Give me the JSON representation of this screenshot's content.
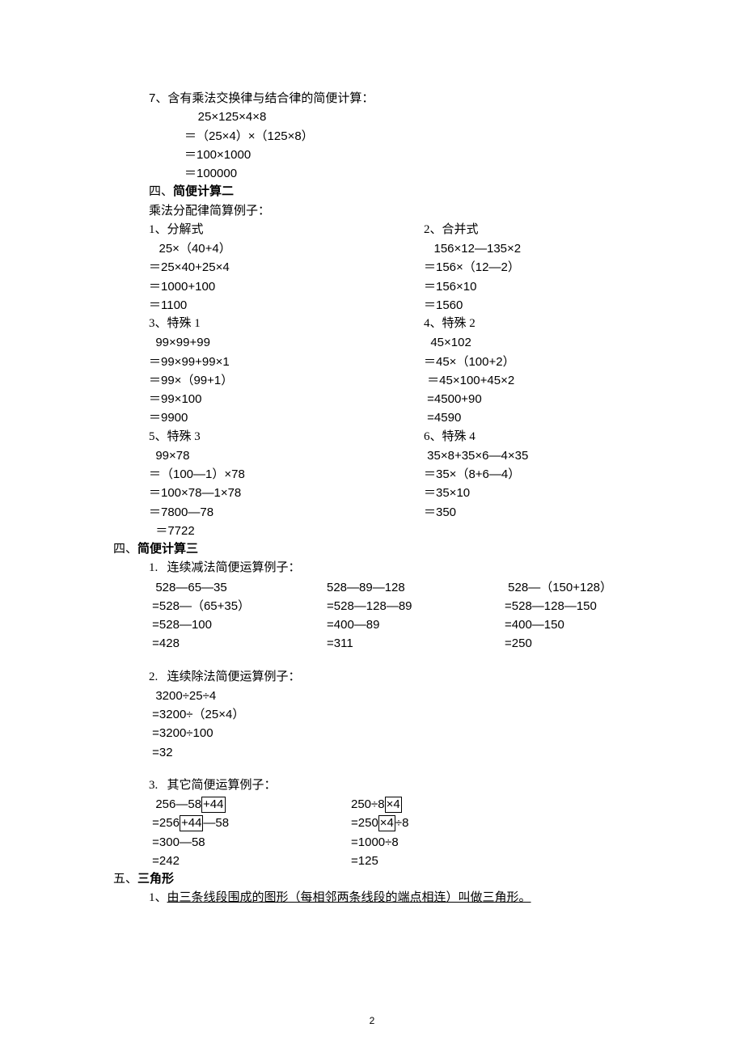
{
  "item7": {
    "heading": "7、含有乘法交换律与结合律的简便计算：",
    "l1": "    25×125×4×8",
    "l2": "＝（25×4）×（125×8）",
    "l3": "＝100×1000",
    "l4": "＝100000"
  },
  "sec4a": {
    "heading_pre": " 四、",
    "heading_bold": "简便计算二",
    "sub": "乘法分配律简算例子："
  },
  "b1": {
    "left_h": "1、分解式",
    "right_h": "2、合并式",
    "l1l": "   25×（40+4）",
    "l1r": "   156×12―135×2",
    "l2l": "＝25×40+25×4",
    "l2r": "＝156×（12―2）",
    "l3l": "＝1000+100",
    "l3r": "＝156×10",
    "l4l": "＝1100",
    "l4r": "＝1560"
  },
  "b2": {
    "left_h": "3、特殊 1",
    "right_h": "4、特殊 2",
    "l1l": "  99×99+99",
    "l1r": "  45×102",
    "l2l": "＝99×99+99×1",
    "l2r": "＝45×（100+2）",
    "l3l": "＝99×（99+1）",
    "l3r": " ＝45×100+45×2",
    "l4l": "＝99×100",
    "l4r": " =4500+90",
    "l5l": "＝9900",
    "l5r": " =4590"
  },
  "b3": {
    "left_h": "5、特殊 3",
    "right_h": "6、特殊 4",
    "l1l": "  99×78",
    "l1r": " 35×8+35×6―4×35",
    "l2l": "＝（100―1）×78",
    "l2r": "＝35×（8+6―4）",
    "l3l": "＝100×78―1×78",
    "l3r": "＝35×10",
    "l4l": "＝7800―78",
    "l4r": "＝350",
    "l5l": "  ＝7722"
  },
  "sec4b": {
    "heading_pre": "四、",
    "heading_bold": "简便计算三"
  },
  "sub1": {
    "heading": "1.   连续减法简便运算例子：",
    "r1c1": "  528―65―35",
    "r1c2": "528―89―128",
    "r1c3": " 528―（150+128）",
    "r2c1": " =528―（65+35）",
    "r2c2": "=528―128―89",
    "r2c3": "=528―128―150",
    "r3c1": " =528―100",
    "r3c2": "=400―89",
    "r3c3": "=400―150",
    "r4c1": " =428",
    "r4c2": "=311",
    "r4c3": "=250"
  },
  "sub2": {
    "heading": "2.   连续除法简便运算例子：",
    "l1": "  3200÷25÷4",
    "l2": " =3200÷（25×4）",
    "l3": " =3200÷100",
    "l4": " =32"
  },
  "sub3": {
    "heading": "3.   其它简便运算例子：",
    "a1pre": "  256―58",
    "a1box": "+44",
    "b1pre": "250÷8",
    "b1box": "×4",
    "a2pre": " =256",
    "a2box": "+44",
    "a2post": "―58",
    "b2pre": "=250",
    "b2box": "×4",
    "b2post": "÷8",
    "a3": " =300―58",
    "b3": "=1000÷8",
    "a4": " =242",
    "b4": "=125"
  },
  "sec5": {
    "heading_pre": "五、",
    "heading_bold": "三角形",
    "item1_pre": "1、",
    "item1_ul": "由三条线段围成的图形（每相邻两条线段的端点相连）叫做三角形。"
  },
  "footer": "2"
}
